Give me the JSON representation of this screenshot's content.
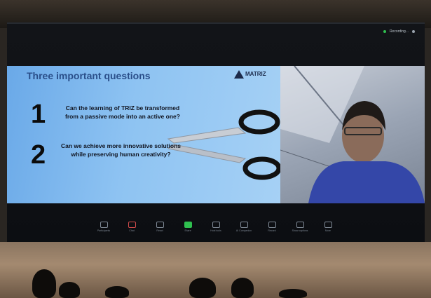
{
  "meeting": {
    "status": "Recording..."
  },
  "slide": {
    "title": "Three important questions",
    "logo": "MATRIZ",
    "questions": [
      {
        "number": "1",
        "text": "Can the learning of TRIZ be transformed from a passive mode into an active one?"
      },
      {
        "number": "2",
        "text": "Can we achieve more innovative solutions while preserving human creativity?"
      }
    ]
  },
  "toolbar": {
    "items": [
      {
        "label": "Participants",
        "icon": "participants-icon"
      },
      {
        "label": "Chat",
        "icon": "chat-icon"
      },
      {
        "label": "React",
        "icon": "react-icon"
      },
      {
        "label": "Share",
        "icon": "share-screen-icon"
      },
      {
        "label": "Host tools",
        "icon": "host-tools-icon"
      },
      {
        "label": "AI Companion",
        "icon": "ai-companion-icon"
      },
      {
        "label": "Record",
        "icon": "record-icon"
      },
      {
        "label": "Show captions",
        "icon": "captions-icon"
      },
      {
        "label": "More",
        "icon": "more-icon"
      }
    ]
  }
}
